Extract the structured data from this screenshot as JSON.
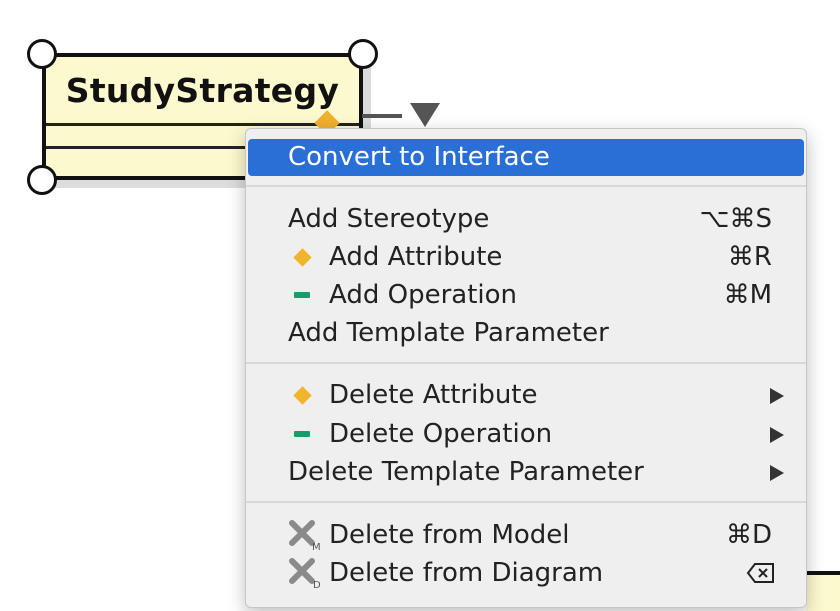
{
  "diagram": {
    "class_name": "StudyStrategy"
  },
  "menu": {
    "items": [
      {
        "label": "Convert to Interface",
        "shortcut": "",
        "highlighted": true
      },
      {
        "label": "Add Stereotype",
        "shortcut": "⌥⌘S"
      },
      {
        "label": "Add Attribute",
        "shortcut": "⌘R",
        "icon": "attribute-diamond-icon"
      },
      {
        "label": "Add Operation",
        "shortcut": "⌘M",
        "icon": "operation-dash-icon"
      },
      {
        "label": "Add Template Parameter",
        "shortcut": ""
      },
      {
        "label": "Delete Attribute",
        "submenu": true,
        "icon": "attribute-diamond-icon"
      },
      {
        "label": "Delete Operation",
        "submenu": true,
        "icon": "operation-dash-icon"
      },
      {
        "label": "Delete Template Parameter",
        "submenu": true
      },
      {
        "label": "Delete from Model",
        "shortcut": "⌘D",
        "icon": "delete-from-model-icon"
      },
      {
        "label": "Delete from Diagram",
        "shortcut": "",
        "icon": "delete-from-diagram-icon",
        "shortcut_icon": "delete-key-icon"
      }
    ]
  },
  "colors": {
    "highlight": "#2a6fd6",
    "class_fill": "#fdf9cf",
    "attribute_icon": "#f1b52c",
    "operation_icon": "#1a9b6c"
  }
}
